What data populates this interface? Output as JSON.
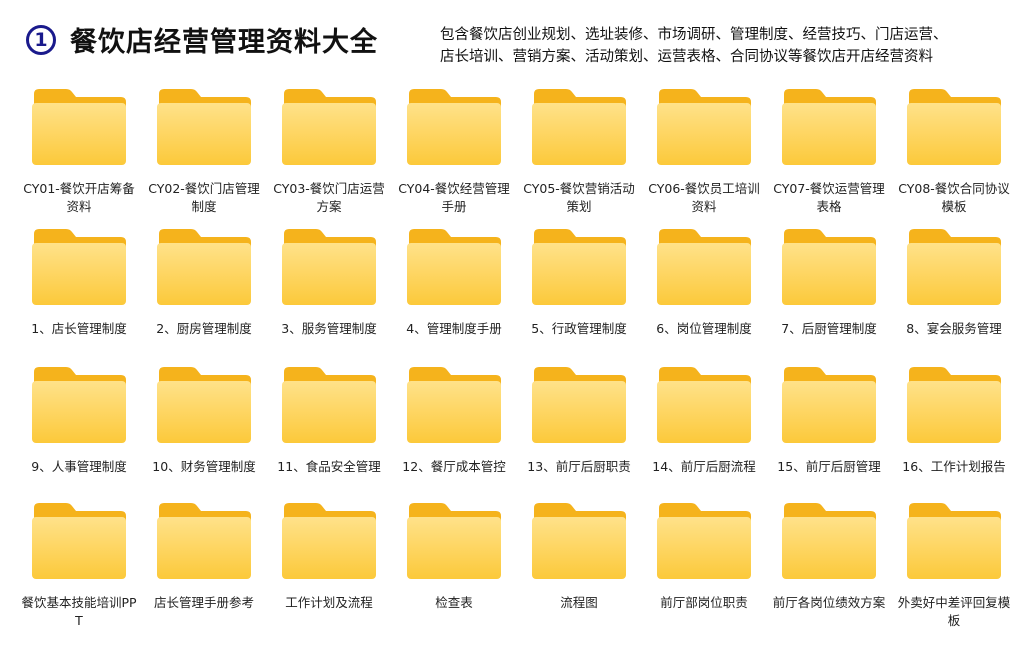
{
  "header": {
    "badge": "1",
    "title": "餐饮店经营管理资料大全",
    "desc_line1": "包含餐饮店创业规划、选址装修、市场调研、管理制度、经营技巧、门店运营、",
    "desc_line2": "店长培训、营销方案、活动策划、运营表格、合同协议等餐饮店开店经营资料"
  },
  "colors": {
    "folder_back": "#f5b31c",
    "folder_front_top": "#ffe28a",
    "folder_front_bottom": "#fcc93a",
    "badge": "#1a1a8c"
  },
  "folders": [
    [
      "CY01-餐饮开店筹备资料",
      "CY02-餐饮门店管理制度",
      "CY03-餐饮门店运营方案",
      "CY04-餐饮经营管理手册",
      "CY05-餐饮营销活动策划",
      "CY06-餐饮员工培训资料",
      "CY07-餐饮运营管理表格",
      "CY08-餐饮合同协议模板"
    ],
    [
      "1、店长管理制度",
      "2、厨房管理制度",
      "3、服务管理制度",
      "4、管理制度手册",
      "5、行政管理制度",
      "6、岗位管理制度",
      "7、后厨管理制度",
      "8、宴会服务管理"
    ],
    [
      "9、人事管理制度",
      "10、财务管理制度",
      "11、食品安全管理",
      "12、餐厅成本管控",
      "13、前厅后厨职责",
      "14、前厅后厨流程",
      "15、前厅后厨管理",
      "16、工作计划报告"
    ],
    [
      "餐饮基本技能培训PPT",
      "店长管理手册参考",
      "工作计划及流程",
      "检查表",
      "流程图",
      "前厅部岗位职责",
      "前厅各岗位绩效方案",
      "外卖好中差评回复模板"
    ]
  ]
}
